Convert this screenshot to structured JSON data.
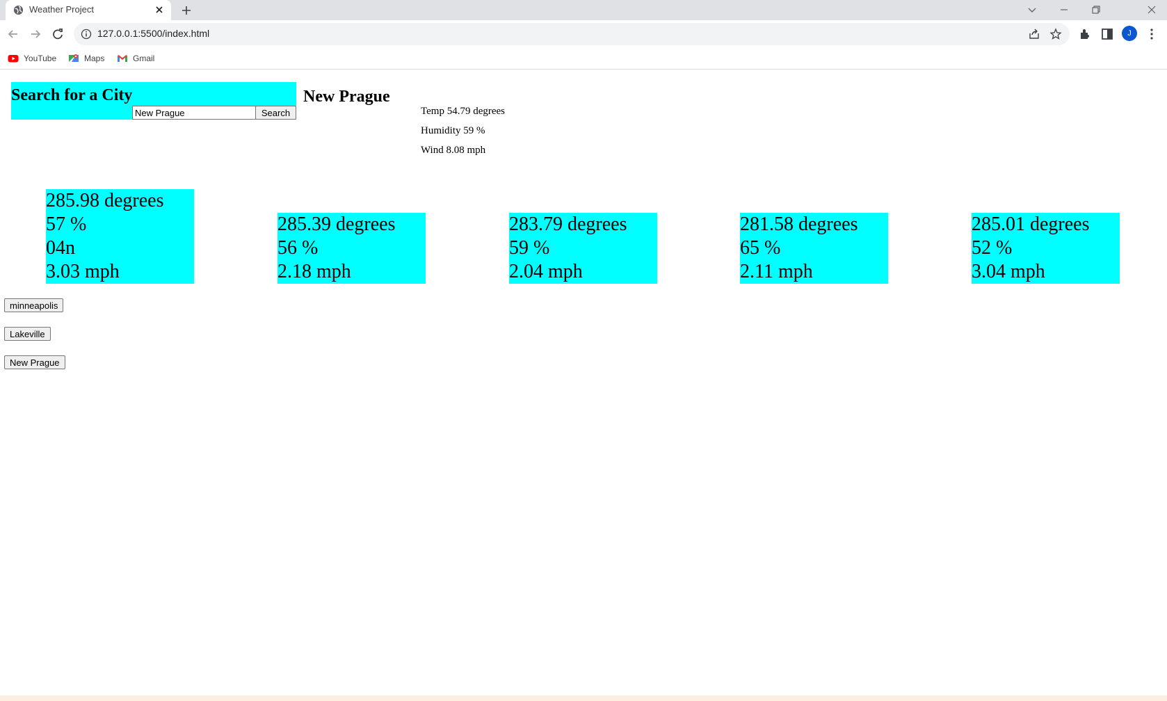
{
  "browser": {
    "tab_title": "Weather Project",
    "url": "127.0.0.1:5500/index.html",
    "avatar_initial": "J",
    "bookmarks": [
      "YouTube",
      "Maps",
      "Gmail"
    ]
  },
  "search": {
    "heading": "Search for a City",
    "input_value": "New Prague",
    "button_label": "Search"
  },
  "current": {
    "city": "New Prague",
    "temp": "Temp 54.79 degrees",
    "humidity": "Humidity 59 %",
    "wind": "Wind 8.08 mph"
  },
  "forecast": [
    {
      "temp": "285.98 degrees",
      "humidity": "57 %",
      "icon": "04n",
      "wind": "3.03 mph"
    },
    {
      "temp": "285.39 degrees",
      "humidity": "56 %",
      "wind": "2.18 mph"
    },
    {
      "temp": "283.79 degrees",
      "humidity": "59 %",
      "wind": "2.04 mph"
    },
    {
      "temp": "281.58 degrees",
      "humidity": "65 %",
      "wind": "2.11 mph"
    },
    {
      "temp": "285.01 degrees",
      "humidity": "52 %",
      "wind": "3.04 mph"
    }
  ],
  "history": [
    "minneapolis",
    "Lakeville",
    "New Prague"
  ]
}
